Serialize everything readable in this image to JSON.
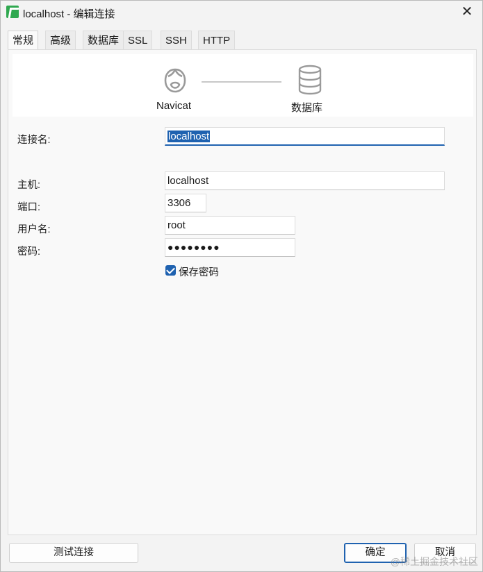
{
  "window": {
    "title": "localhost - 编辑连接",
    "close_glyph": "✕"
  },
  "tabs": [
    {
      "label": "常规",
      "active": true
    },
    {
      "label": "高级",
      "active": false
    },
    {
      "label": "数据库",
      "active": false
    },
    {
      "label": "SSL",
      "active": false
    },
    {
      "label": "SSH",
      "active": false
    },
    {
      "label": "HTTP",
      "active": false
    }
  ],
  "banner": {
    "left_label": "Navicat",
    "right_label": "数据库",
    "left_icon": "navicat-logo-icon",
    "right_icon": "database-icon"
  },
  "form": {
    "connection_name_label": "连接名:",
    "connection_name_value": "localhost",
    "host_label": "主机:",
    "host_value": "localhost",
    "port_label": "端口:",
    "port_value": "3306",
    "username_label": "用户名:",
    "username_value": "root",
    "password_label": "密码:",
    "password_value": "●●●●●●●●",
    "save_password_label": "保存密码",
    "save_password_checked": true
  },
  "footer": {
    "test_connection_label": "测试连接",
    "ok_label": "确定",
    "cancel_label": "取消"
  },
  "watermark": "@稀土掘金技术社区",
  "colors": {
    "accent": "#1f62b0",
    "app_icon": "#2fa84f"
  }
}
